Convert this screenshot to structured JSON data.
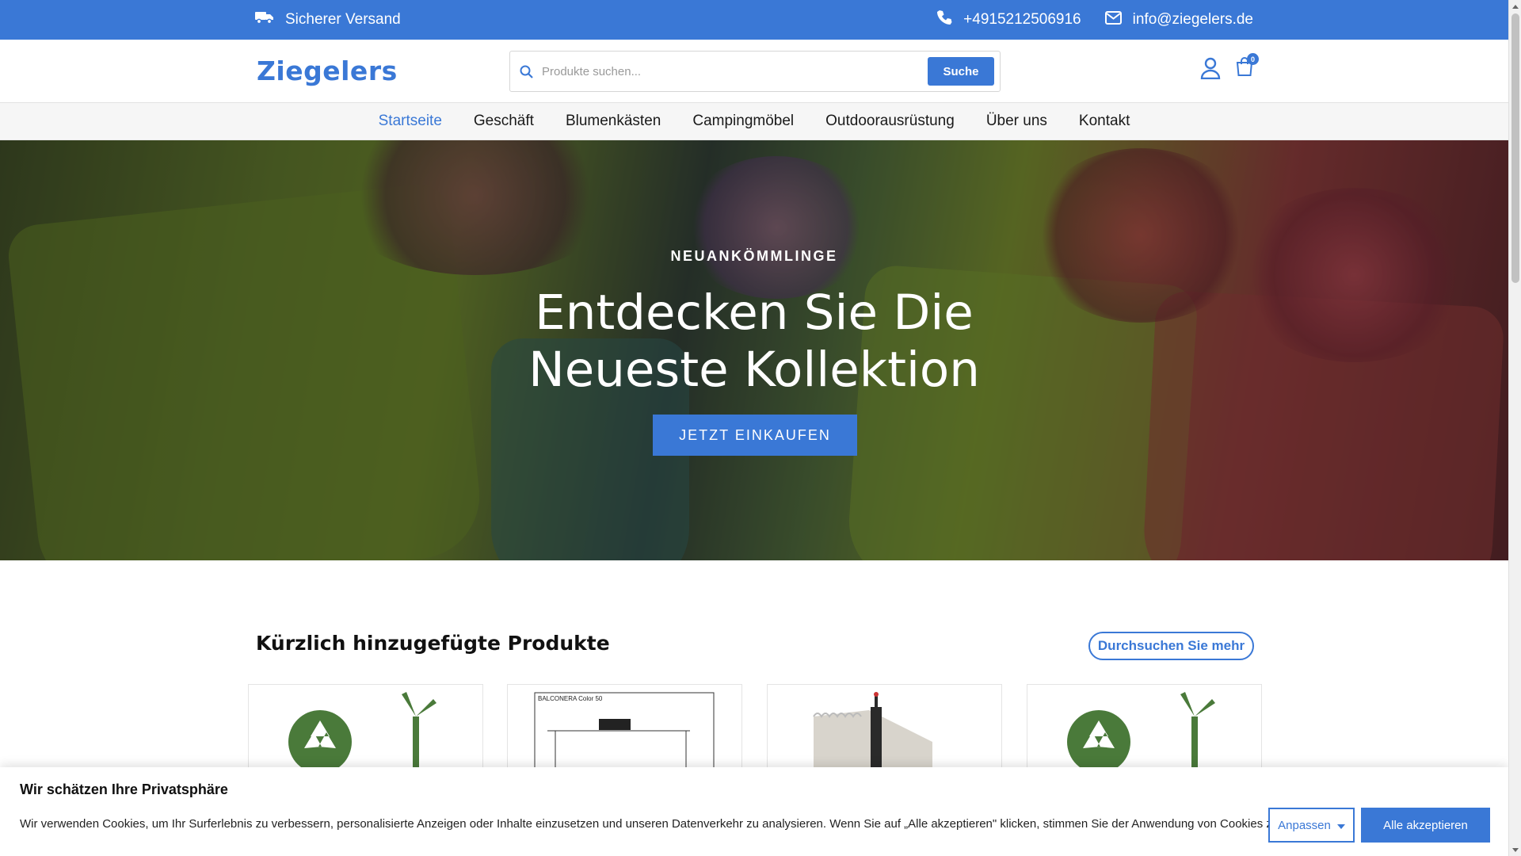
{
  "colors": {
    "brand": "#3a78d6",
    "text": "#1a1a1a"
  },
  "topbar": {
    "shipping_icon": "truck-icon",
    "shipping_label": "Sicherer Versand",
    "phone_icon": "phone-icon",
    "phone": "+4915212506916",
    "email_icon": "envelope-icon",
    "email": "info@ziegelers.de"
  },
  "header": {
    "logo": "Ziegelers",
    "search": {
      "placeholder": "Produkte suchen...",
      "value": "",
      "button_label": "Suche"
    },
    "account_icon": "user-icon",
    "cart_icon": "cart-icon",
    "cart_count": "0"
  },
  "nav": {
    "items": [
      {
        "label": "Startseite",
        "active": true
      },
      {
        "label": "Geschäft"
      },
      {
        "label": "Blumenkästen"
      },
      {
        "label": "Campingmöbel"
      },
      {
        "label": "Outdoorausrüstung"
      },
      {
        "label": "Über uns"
      },
      {
        "label": "Kontakt"
      }
    ]
  },
  "hero": {
    "kicker": "NEUANKÖMMLINGE",
    "headline_line1": "Entdecken Sie Die",
    "headline_line2": "Neueste Kollektion",
    "cta_label": "JETZT EINKAUFEN"
  },
  "products": {
    "title": "Kürzlich hinzugefügte Produkte",
    "more_label": "Durchsuchen Sie mehr",
    "cards": [
      {
        "image_icon": "recycle-windmill-image"
      },
      {
        "image_icon": "balconera-diagram-image",
        "image_text": "BALCONERA Color 50"
      },
      {
        "image_icon": "planter-box-image"
      },
      {
        "image_icon": "recycle-windmill-image"
      }
    ]
  },
  "cookie": {
    "title": "Wir schätzen Ihre Privatsphäre",
    "text": "Wir verwenden Cookies, um Ihr Surferlebnis zu verbessern, personalisierte Anzeigen oder Inhalte einzusetzen und unseren Datenverkehr zu analysieren. Wenn Sie auf „Alle akzeptieren\" klicken, stimmen Sie der Anwendung von Cookies zu.",
    "adjust_label": "Anpassen",
    "accept_label": "Alle akzeptieren"
  }
}
